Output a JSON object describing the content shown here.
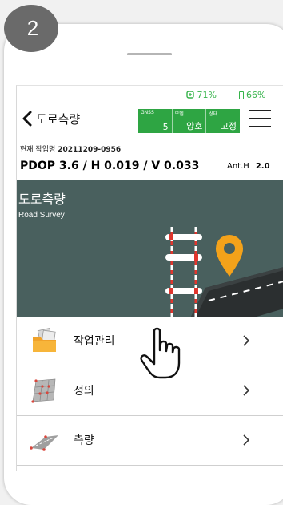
{
  "step_number": "2",
  "status_bar": {
    "wifi_value": "71%",
    "battery_value": "66%",
    "status_color": "#36b34a"
  },
  "header": {
    "title": "도로측량",
    "gnss": {
      "cells": [
        {
          "label": "GNSS",
          "value": "5"
        },
        {
          "label": "모뎀",
          "value": "양호"
        },
        {
          "label": "상태",
          "value": "고정"
        }
      ],
      "color": "#2ea543"
    }
  },
  "job": {
    "label": "현재 작업명",
    "value": "20211209-0956"
  },
  "precision": {
    "text": "PDOP 3.6 / H 0.019 / V 0.033",
    "anth_label": "Ant.H",
    "anth_value": "2.0"
  },
  "hero": {
    "title": "도로측량",
    "subtitle": "Road Survey",
    "background": "#49605e",
    "pin_color": "#f4a21a"
  },
  "menu": [
    {
      "label": "작업관리",
      "icon": "folder-documents-icon"
    },
    {
      "label": "정의",
      "icon": "grid-definition-icon"
    },
    {
      "label": "측량",
      "icon": "road-survey-icon"
    }
  ],
  "icons": {
    "back": "chevron-left-icon",
    "menu": "hamburger-menu-icon",
    "pointer": "pointing-hand-icon"
  }
}
